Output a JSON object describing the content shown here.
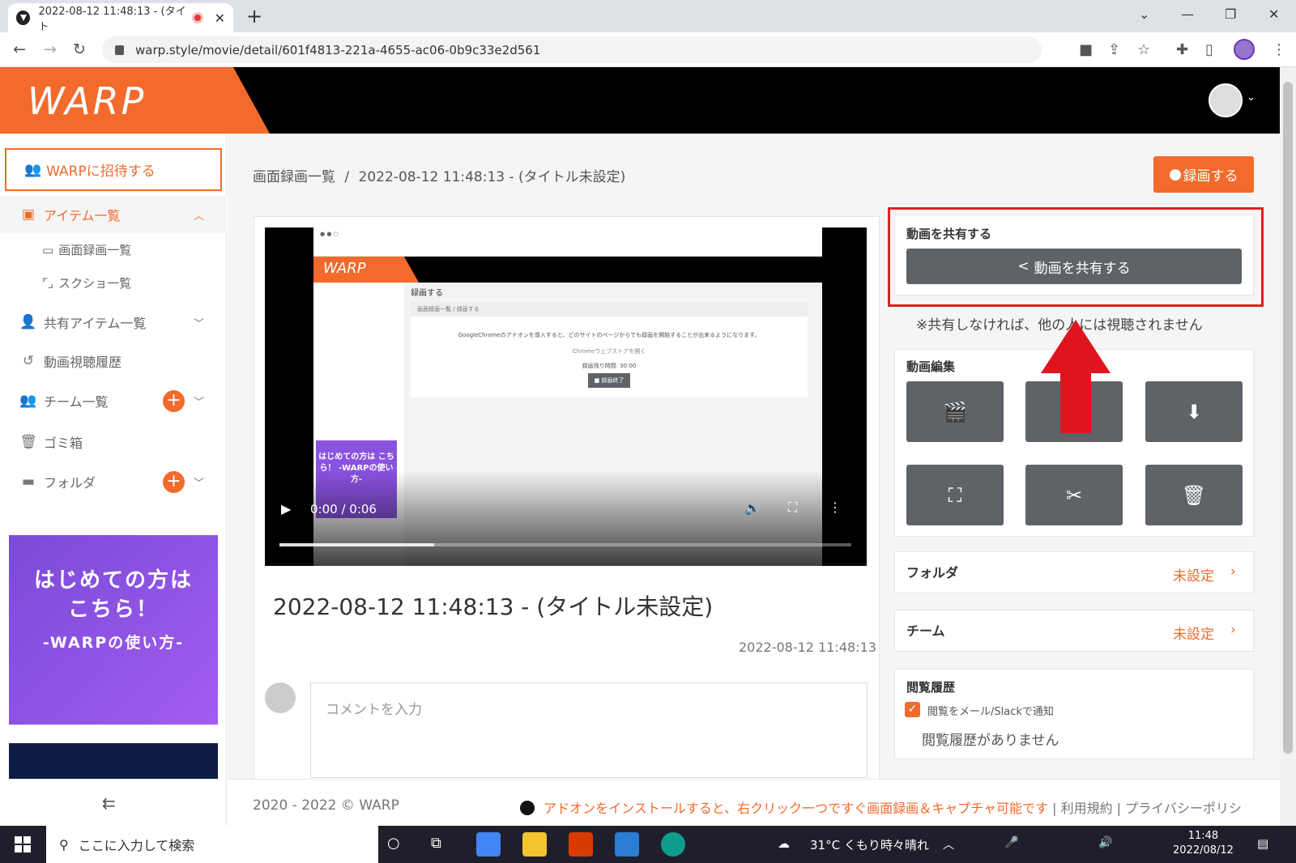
{
  "browser": {
    "tab_title": "2022-08-12 11:48:13 - (タイト",
    "url": "warp.style/movie/detail/601f4813-221a-4655-ac06-0b9c33e2d561"
  },
  "app": {
    "logo": "WARP"
  },
  "sidebar": {
    "invite_label": "WARPに招待する",
    "items_label": "アイテム一覧",
    "sub_screen": "画面録画一覧",
    "sub_screenshot": "スクショ一覧",
    "shared_items": "共有アイテム一覧",
    "history": "動画視聴履歴",
    "teams": "チーム一覧",
    "trash": "ゴミ箱",
    "folder": "フォルダ",
    "promo_line1": "はじめての方は",
    "promo_line2": "こちら！",
    "promo_line3": "-WARPの使い方-"
  },
  "main": {
    "breadcrumb_root": "画面録画一覧",
    "breadcrumb_sep": "/",
    "breadcrumb_current": "2022-08-12 11:48:13 - (タイトル未設定)",
    "record_button": "録画する",
    "video_time": "0:00 / 0:06",
    "video_progress": 0.27,
    "video_title": "2022-08-12 11:48:13 - (タイトル未設定)",
    "video_date": "2022-08-12 11:48:13",
    "comment_placeholder": "コメントを入力"
  },
  "inner_screenshot": {
    "record_heading": "録画する",
    "crumb": "画面録画一覧 / 録画する",
    "notice": "GoogleChromeのアドオンを導入すると、どのサイトのページからでも録画を開始することが出来るようになります。",
    "store_link": "Chromeウェブストアを開く",
    "remaining": "録画残り時間: 30:00",
    "end_button": "■ 録画終了",
    "promo": "はじめての方は こちら！ -WARPの使い方-"
  },
  "share_panel": {
    "title": "動画を共有する",
    "button": "動画を共有する",
    "note": "※共有しなければ、他の人には視聴されません"
  },
  "edit_panel": {
    "title": "動画編集"
  },
  "folder_row": {
    "label": "フォルダ",
    "value": "未設定"
  },
  "team_row": {
    "label": "チーム",
    "value": "未設定"
  },
  "history_panel": {
    "title": "閲覧履歴",
    "notify_label": "閲覧をメール/Slackで通知",
    "empty": "閲覧履歴がありません"
  },
  "footer": {
    "copyright": "2020 - 2022 © WARP",
    "addon_text": "アドオンをインストールすると、右クリック一つですぐ画面録画＆キャプチャ可能です",
    "terms": "利用規約",
    "privacy": "プライバシーポリシ"
  },
  "taskbar": {
    "search_placeholder": "ここに入力して検索",
    "weather": "31°C くもり時々晴れ",
    "time": "11:48",
    "date": "2022/08/12"
  },
  "colors": {
    "accent": "#f26a2c",
    "button_gray": "#5f6368",
    "highlight_red": "#e02020"
  }
}
